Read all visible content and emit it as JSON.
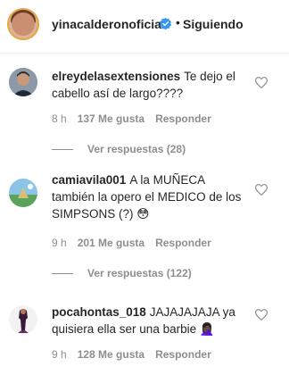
{
  "header": {
    "username": "yinacalderonoficial",
    "separator": "•",
    "follow_status": "Siguiendo",
    "verified_icon": "verified-badge-icon"
  },
  "comments": [
    {
      "user": "elreydelasextensiones",
      "text": "Te dejo el cabello así de largo????",
      "time": "8 h",
      "likes": "137 Me gusta",
      "reply": "Responder",
      "view_replies": "Ver respuestas (28)"
    },
    {
      "user": "camiavila001",
      "text": "A la MUÑECA también la opero el MEDICO de los SIMPSONS (?) 😳",
      "time": "9 h",
      "likes": "201 Me gusta",
      "reply": "Responder",
      "view_replies": "Ver respuestas (122)"
    },
    {
      "user": "pocahontas_018",
      "text": "JAJAJAJAJA ya quisiera ella ser una barbie 🤦🏿‍♀️",
      "time": "9 h",
      "likes": "128 Me gusta",
      "reply": "Responder"
    }
  ],
  "colors": {
    "text": "#262626",
    "secondary": "#8e8e8e",
    "verified": "#3897f0"
  }
}
